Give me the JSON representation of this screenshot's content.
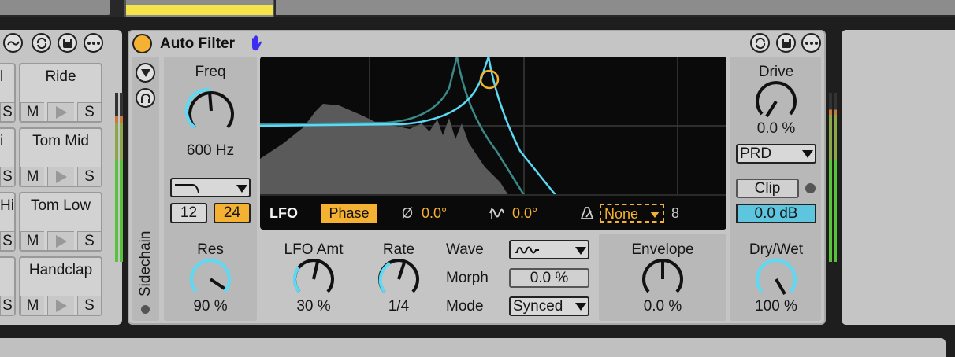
{
  "drum_rack": {
    "pads": [
      {
        "name": "Ride",
        "left_label": "l"
      },
      {
        "name": "Tom Mid",
        "left_label": "i"
      },
      {
        "name": "Tom Low",
        "left_label": "Hi"
      },
      {
        "name": "Handclap",
        "left_label": ""
      }
    ],
    "mute_label": "M",
    "solo_label": "S",
    "left_solo_label": "S"
  },
  "device": {
    "title": "Auto Filter",
    "sidechain_label": "Sidechain",
    "freq": {
      "label": "Freq",
      "value": "600 Hz"
    },
    "res": {
      "label": "Res",
      "value": "90 %"
    },
    "slope": {
      "options": [
        "12",
        "24"
      ],
      "selected": "24"
    },
    "filter_type_icon": "lowpass-curve-icon",
    "lfo": {
      "label": "LFO",
      "mode_button": "Phase",
      "phase_value": "0.0°",
      "offset_value": "0.0°",
      "sync_value": "None",
      "sync_num": "8",
      "amount": {
        "label": "LFO Amt",
        "value": "30 %"
      },
      "rate": {
        "label": "Rate",
        "value": "1/4"
      },
      "wave_label": "Wave",
      "morph_label": "Morph",
      "morph_value": "0.0 %",
      "mode_label": "Mode",
      "mode_value": "Synced"
    },
    "envelope": {
      "label": "Envelope",
      "value": "0.0 %"
    },
    "drive": {
      "label": "Drive",
      "value": "0.0 %",
      "mode": "PRD"
    },
    "clip": {
      "label": "Clip",
      "value": "0.0 dB"
    },
    "drywet": {
      "label": "Dry/Wet",
      "value": "100 %"
    }
  },
  "colors": {
    "accent": "#5bd9f5",
    "orange": "#f5b131",
    "panel": "#c5c5c5",
    "screen": "#0a0a0a",
    "clip_blue": "#5dc6de"
  }
}
